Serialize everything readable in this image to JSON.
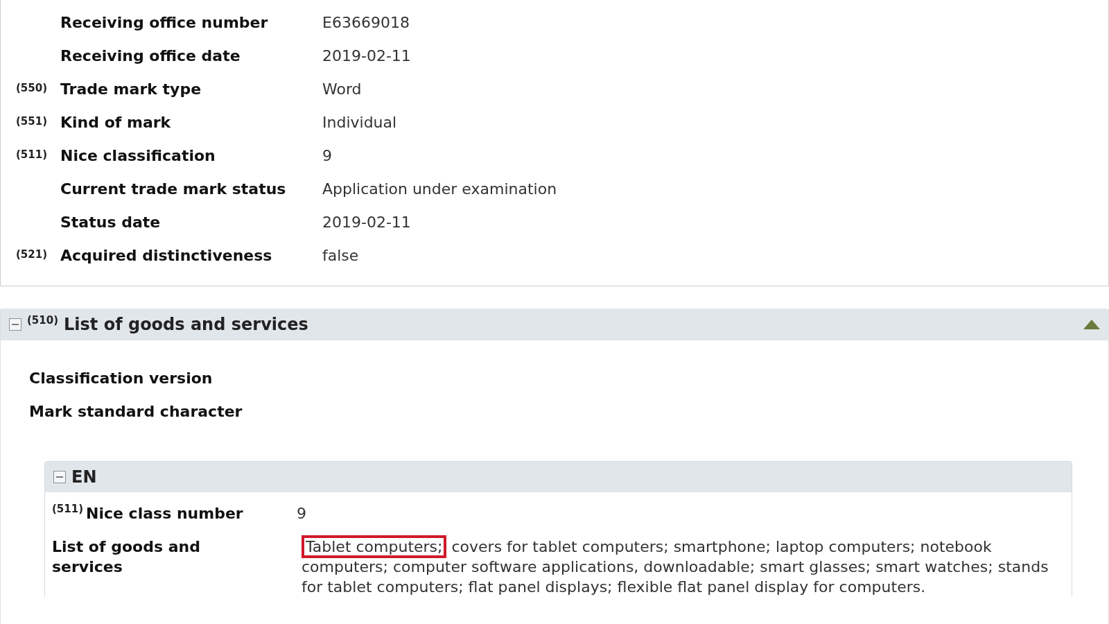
{
  "details": {
    "rows": [
      {
        "label": "Receiving office number",
        "value": "E63669018"
      },
      {
        "label": "Receiving office date",
        "value": "2019-02-11"
      },
      {
        "code": "(550)",
        "label": "Trade mark type",
        "value": "Word"
      },
      {
        "code": "(551)",
        "label": "Kind of mark",
        "value": "Individual"
      },
      {
        "code": "(511)",
        "label": "Nice classification",
        "value": "9"
      },
      {
        "label": "Current trade mark status",
        "value": "Application under examination"
      },
      {
        "label": "Status date",
        "value": "2019-02-11"
      },
      {
        "code": "(521)",
        "label": "Acquired distinctiveness",
        "value": "false"
      }
    ]
  },
  "goods_section": {
    "code": "(510)",
    "title": "List of goods and services",
    "expanded": true,
    "labels": [
      "Classification version",
      "Mark standard character"
    ],
    "language_panel": {
      "title": "EN",
      "expanded": true,
      "class_row": {
        "code": "(511)",
        "label": "Nice class number",
        "value": "9"
      },
      "goods_row": {
        "label": "List of goods and services",
        "highlighted": "Tablet computers;",
        "rest": "covers for tablet computers; smartphone; laptop computers; notebook computers; computer software applications, downloadable; smart glasses; smart watches; stands for tablet computers; flat panel displays; flexible flat panel display for computers."
      }
    }
  }
}
